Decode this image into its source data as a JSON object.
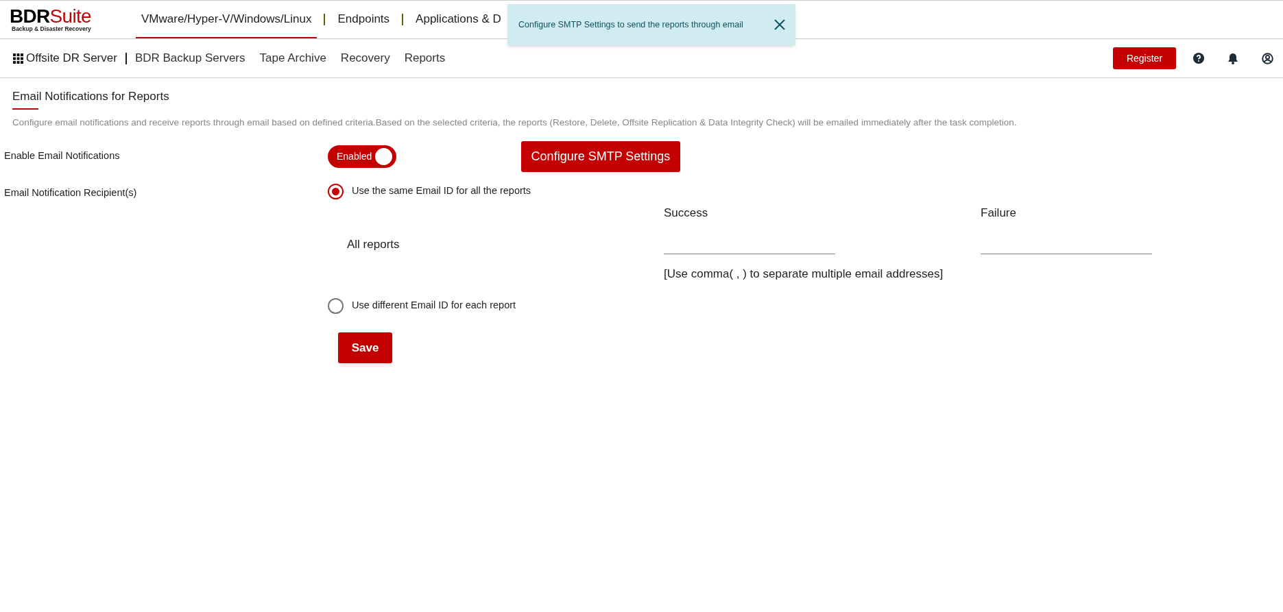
{
  "logo": {
    "brand_dark": "BDR",
    "brand_red": "Suite",
    "tagline": "Backup & Disaster Recovery"
  },
  "top_tabs": [
    {
      "label": "VMware/Hyper-V/Windows/Linux",
      "selected": true
    },
    {
      "label": "Endpoints",
      "selected": false
    },
    {
      "label": "Applications & D",
      "selected": false
    }
  ],
  "toast": {
    "message": "Configure SMTP Settings to send the reports through email"
  },
  "sub_nav": {
    "title": "Offsite DR Server",
    "items": [
      "BDR Backup Servers",
      "Tape Archive",
      "Recovery",
      "Reports"
    ],
    "register": "Register"
  },
  "page": {
    "title": "Email Notifications for Reports",
    "description": "Configure email notifications and receive reports through email based on defined criteria.Based on the selected criteria, the reports (Restore, Delete, Offsite Replication & Data Integrity Check) will be emailed immediately after the task completion."
  },
  "enable": {
    "label": "Enable Email Notifications",
    "toggle_text": "Enabled",
    "on": true,
    "smtp_button": "Configure SMTP Settings"
  },
  "recipients": {
    "label": "Email Notification Recipient(s)",
    "options": [
      {
        "label": "Use the same Email ID for all the reports",
        "selected": true
      },
      {
        "label": "Use different Email ID for each report",
        "selected": false
      }
    ],
    "row_label": "All reports",
    "columns": [
      "Success",
      "Failure"
    ],
    "hint": "[Use comma( , ) to separate multiple email addresses]"
  },
  "save": "Save"
}
